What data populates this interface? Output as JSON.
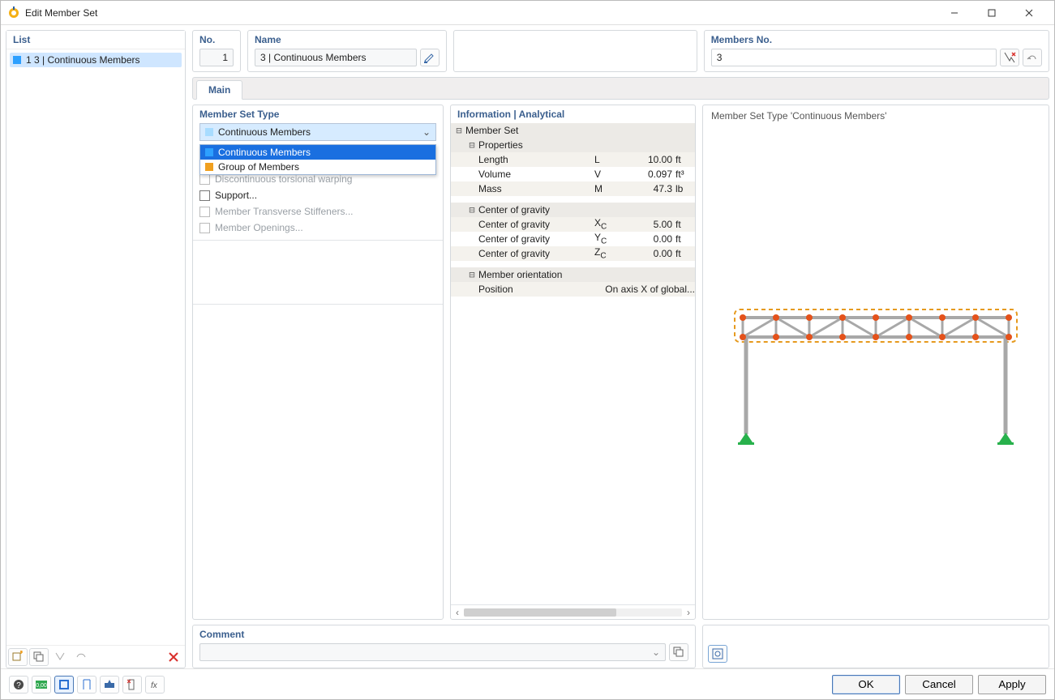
{
  "window": {
    "title": "Edit Member Set"
  },
  "list": {
    "header": "List",
    "items": [
      {
        "id": 1,
        "text": "1  3 | Continuous Members",
        "color": "#2da0ff",
        "selected": true
      }
    ]
  },
  "fields": {
    "no_label": "No.",
    "no_value": "1",
    "name_label": "Name",
    "name_value": "3 | Continuous Members",
    "members_label": "Members No.",
    "members_value": "3"
  },
  "tabs": [
    {
      "id": "main",
      "label": "Main",
      "active": true
    }
  ],
  "member_set_type": {
    "label": "Member Set Type",
    "selected": "Continuous Members",
    "options": [
      {
        "label": "Continuous Members",
        "color": "#2da0ff",
        "selected": true
      },
      {
        "label": "Group of Members",
        "color": "#f0a020",
        "selected": false
      }
    ],
    "checks": [
      {
        "label": "Discontinuous torsional warping",
        "enabled": false,
        "checked": false
      },
      {
        "label": "Support...",
        "enabled": true,
        "checked": false
      },
      {
        "label": "Member Transverse Stiffeners...",
        "enabled": false,
        "checked": false
      },
      {
        "label": "Member Openings...",
        "enabled": false,
        "checked": false
      }
    ]
  },
  "info": {
    "header": "Information | Analytical",
    "root": "Member Set",
    "properties_header": "Properties",
    "properties": [
      {
        "name": "Length",
        "sym": "L",
        "val": "10.00",
        "unit": "ft"
      },
      {
        "name": "Volume",
        "sym": "V",
        "val": "0.097",
        "unit": "ft³"
      },
      {
        "name": "Mass",
        "sym": "M",
        "val": "47.3",
        "unit": "lb"
      }
    ],
    "cog_header": "Center of gravity",
    "cog": [
      {
        "name": "Center of gravity",
        "sym": "X",
        "sub": "C",
        "val": "5.00",
        "unit": "ft"
      },
      {
        "name": "Center of gravity",
        "sym": "Y",
        "sub": "C",
        "val": "0.00",
        "unit": "ft"
      },
      {
        "name": "Center of gravity",
        "sym": "Z",
        "sub": "C",
        "val": "0.00",
        "unit": "ft"
      }
    ],
    "orientation_header": "Member orientation",
    "orientation_row": {
      "name": "Position",
      "val": "On axis X of global..."
    }
  },
  "preview": {
    "title": "Member Set Type 'Continuous Members'"
  },
  "comment": {
    "label": "Comment",
    "value": ""
  },
  "buttons": {
    "ok": "OK",
    "cancel": "Cancel",
    "apply": "Apply"
  },
  "colors": {
    "accent": "#3b5f8e",
    "sel_bg": "#cfe6ff",
    "dd_sel": "#1a6fe0"
  }
}
